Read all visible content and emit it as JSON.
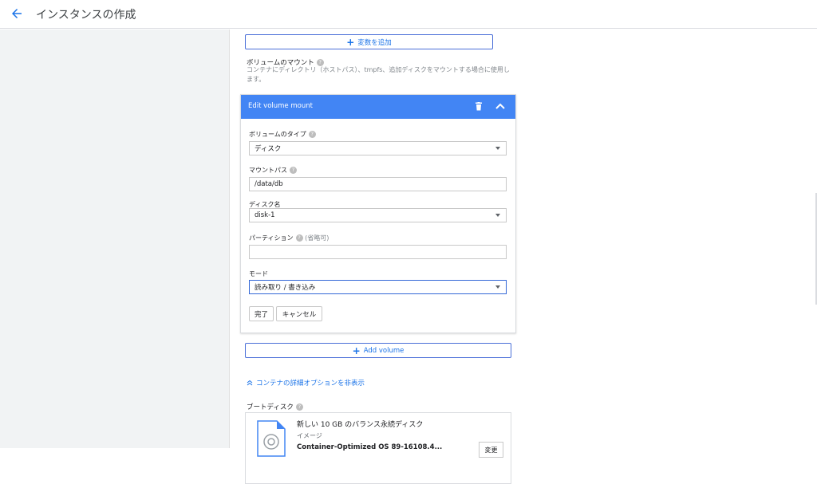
{
  "header": {
    "title": "インスタンスの作成"
  },
  "env": {
    "add_variable_label": "変数を追加"
  },
  "volume_mounts": {
    "title": "ボリュームのマウント",
    "description": "コンテナにディレクトリ（ホストパス）、tmpfs、追加ディスクをマウントする場合に使用します。",
    "card": {
      "title": "Edit volume mount",
      "volume_type_label": "ボリュームのタイプ",
      "volume_type_value": "ディスク",
      "mount_path_label": "マウントパス",
      "mount_path_value": "/data/db",
      "disk_name_label": "ディスク名",
      "disk_name_value": "disk-1",
      "partition_label": "パーティション",
      "partition_optional": "(省略可)",
      "partition_value": "",
      "mode_label": "モード",
      "mode_value": "読み取り / 書き込み",
      "done_label": "完了",
      "cancel_label": "キャンセル"
    },
    "add_volume_label": "Add volume"
  },
  "container_options": {
    "hide_advanced_label": "コンテナの詳細オプションを非表示"
  },
  "boot_disk": {
    "title": "ブートディスク",
    "name": "新しい 10 GB のバランス永続ディスク",
    "image_label": "イメージ",
    "os": "Container-Optimized OS 89-16108.4...",
    "change_label": "変更"
  },
  "icons": {
    "back": "arrow-left-icon",
    "help": "question-icon",
    "add": "plus-icon",
    "delete": "trash-icon",
    "collapse": "chevron-up-icon",
    "dropdown": "caret-down-icon",
    "hide": "double-chevron-up-icon",
    "disk": "disk-image-icon"
  },
  "colors": {
    "accent": "#1a73e8",
    "card_header": "#4285f4"
  }
}
